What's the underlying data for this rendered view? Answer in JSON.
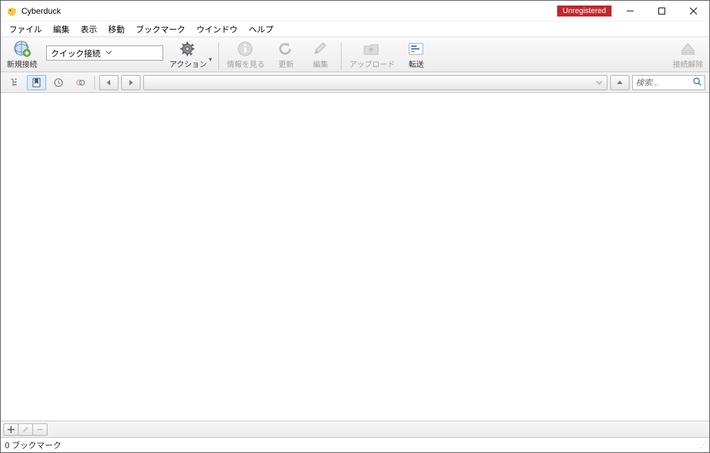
{
  "window": {
    "title": "Cyberduck",
    "unregistered_label": "Unregistered"
  },
  "menu": {
    "file": "ファイル",
    "edit": "編集",
    "view": "表示",
    "go": "移動",
    "bookmark": "ブックマーク",
    "window": "ウインドウ",
    "help": "ヘルプ"
  },
  "toolbar": {
    "new_connection": "新規接続",
    "quick_connect": "クイック接続",
    "action": "アクション",
    "get_info": "情報を見る",
    "refresh": "更新",
    "edit": "編集",
    "upload": "アップロード",
    "transfers": "転送",
    "disconnect": "接続解除"
  },
  "nav": {
    "search_placeholder": "検索..."
  },
  "status": {
    "bookmarks": "0 ブックマーク"
  }
}
